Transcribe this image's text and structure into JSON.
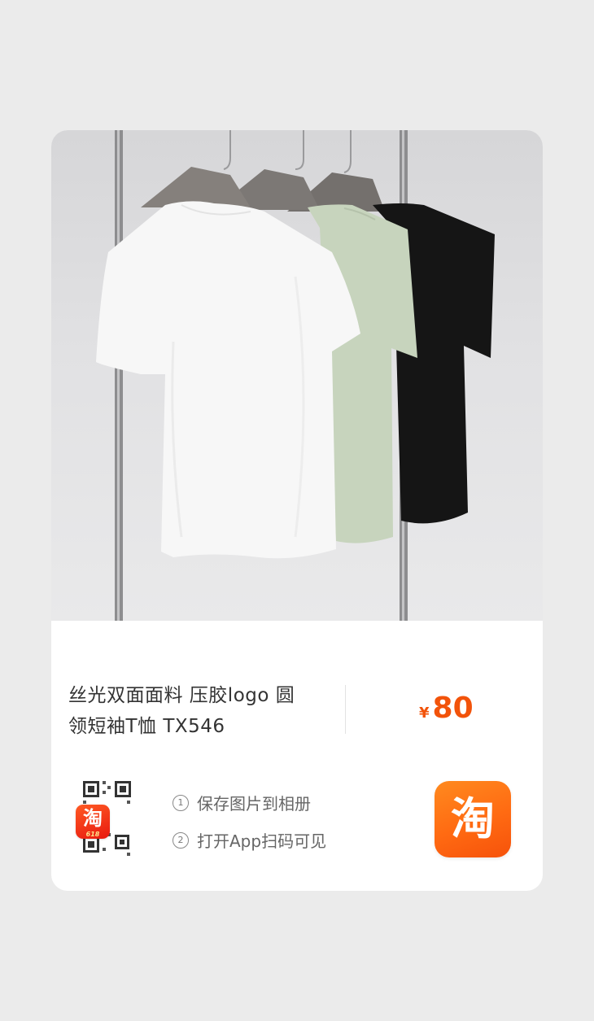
{
  "product": {
    "title_line1": "丝光双面面料 压胶logo 圆",
    "title_line2": "领短袖T恤 TX546",
    "price_symbol": "¥",
    "price_value": "80"
  },
  "steps": [
    {
      "number": "1",
      "label": "保存图片到相册"
    },
    {
      "number": "2",
      "label": "打开App扫码可见"
    }
  ],
  "qr_badge": {
    "glyph": "淘",
    "sub": "618"
  },
  "taobao_logo": {
    "glyph": "淘"
  },
  "colors": {
    "price": "#f2530a",
    "taobao_orange": "#ff6a12",
    "badge_red": "#e8190f",
    "shirt_white": "#f7f7f7",
    "shirt_green": "#c7d4bd",
    "shirt_black": "#151515"
  },
  "icons": [
    "qr-code-icon",
    "taobao-logo-icon",
    "taobao-badge-icon"
  ]
}
